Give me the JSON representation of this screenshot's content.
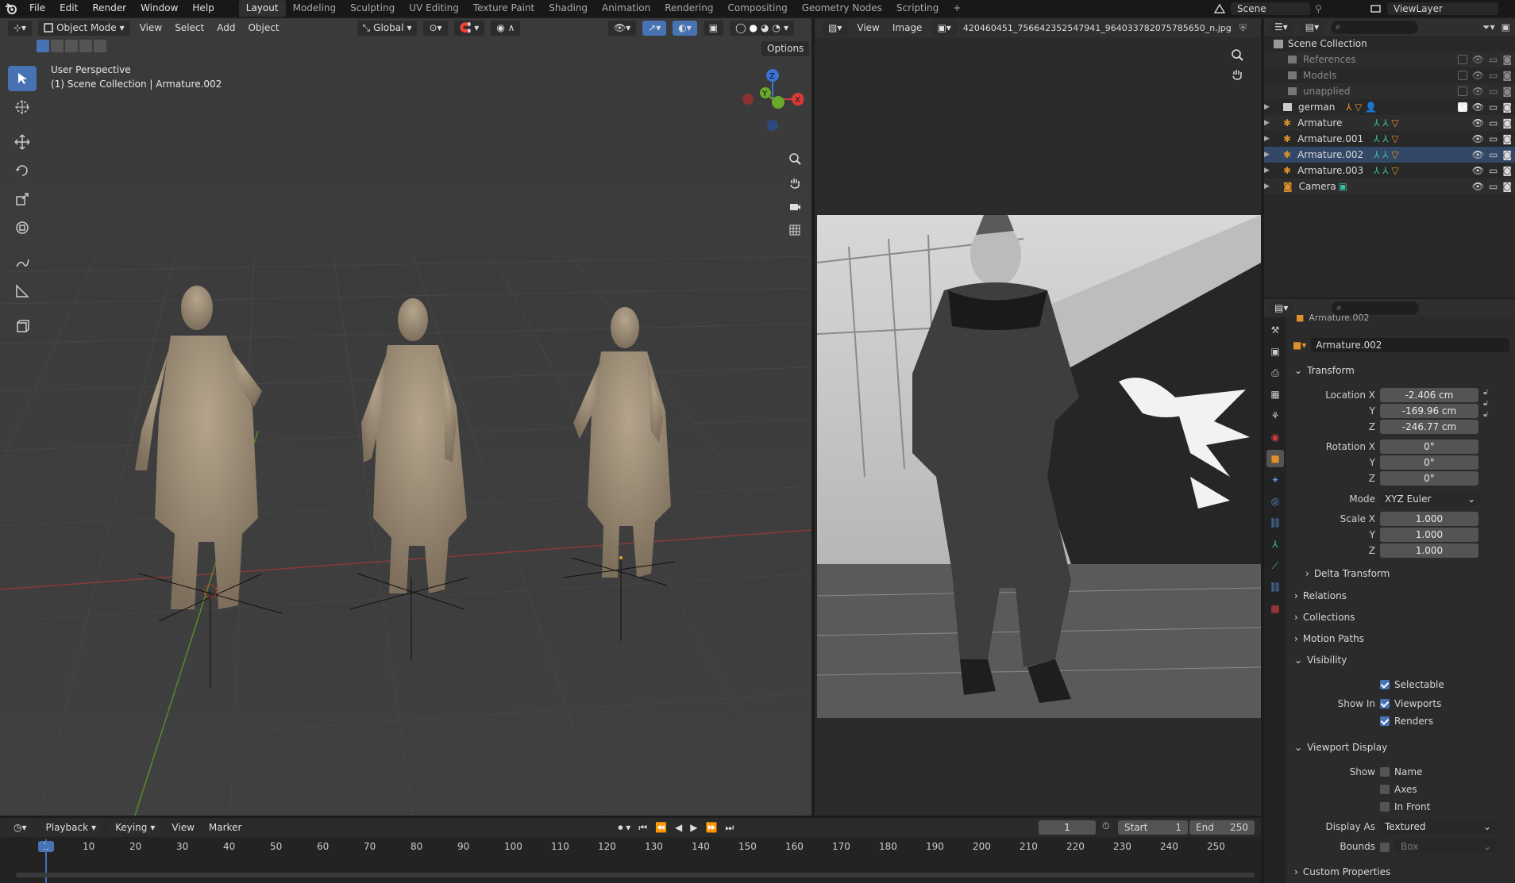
{
  "topbar": {
    "menus": [
      "File",
      "Edit",
      "Render",
      "Window",
      "Help"
    ],
    "workspaces": [
      "Layout",
      "Modeling",
      "Sculpting",
      "UV Editing",
      "Texture Paint",
      "Shading",
      "Animation",
      "Rendering",
      "Compositing",
      "Geometry Nodes",
      "Scripting"
    ],
    "active_workspace": "Layout",
    "scene": "Scene",
    "view_layer": "ViewLayer"
  },
  "viewport": {
    "mode": "Object Mode",
    "menus": [
      "View",
      "Select",
      "Add",
      "Object"
    ],
    "transform_orientation": "Global",
    "options": "Options",
    "overlay_title": "User Perspective",
    "overlay_sub": "(1) Scene Collection | Armature.002",
    "gizmo": {
      "x": "X",
      "y": "Y",
      "z": "Z"
    }
  },
  "image_editor": {
    "menus": [
      "View",
      "Image"
    ],
    "filename": "420460451_756642352547941_964033782075785650_n.jpg"
  },
  "outliner": {
    "root": "Scene Collection",
    "items": [
      {
        "label": "References",
        "dim": true
      },
      {
        "label": "Models",
        "dim": true
      },
      {
        "label": "unapplied",
        "dim": true
      },
      {
        "label": "german",
        "dim": false
      },
      {
        "label": "Armature",
        "dim": false
      },
      {
        "label": "Armature.001",
        "dim": false
      },
      {
        "label": "Armature.002",
        "dim": false
      },
      {
        "label": "Armature.003",
        "dim": false
      },
      {
        "label": "Camera",
        "dim": false
      }
    ]
  },
  "properties": {
    "crumb": "Armature.002",
    "object_name": "Armature.002",
    "transform": {
      "title": "Transform",
      "location_x_label": "Location X",
      "location_x": "-2.406 cm",
      "y_label": "Y",
      "location_y": "-169.96 cm",
      "z_label": "Z",
      "location_z": "-246.77 cm",
      "rotation_x_label": "Rotation X",
      "rotation_x": "0°",
      "rotation_y": "0°",
      "rotation_z": "0°",
      "mode_label": "Mode",
      "mode": "XYZ Euler",
      "scale_x_label": "Scale X",
      "scale_x": "1.000",
      "scale_y": "1.000",
      "scale_z": "1.000"
    },
    "delta_transform": "Delta Transform",
    "relations": "Relations",
    "collections": "Collections",
    "motion_paths": "Motion Paths",
    "visibility": {
      "title": "Visibility",
      "selectable": "Selectable",
      "show_in_label": "Show In",
      "viewports": "Viewports",
      "renders": "Renders"
    },
    "viewport_display": {
      "title": "Viewport Display",
      "show_label": "Show",
      "name": "Name",
      "axes": "Axes",
      "in_front": "In Front",
      "display_as_label": "Display As",
      "display_as": "Textured",
      "bounds_label": "Bounds",
      "bounds": "Box"
    },
    "custom_properties": "Custom Properties"
  },
  "timeline": {
    "menus": [
      "Playback",
      "Keying",
      "View",
      "Marker"
    ],
    "current_frame": "1",
    "start_label": "Start",
    "start": "1",
    "end_label": "End",
    "end": "250",
    "ticks": [
      "10",
      "20",
      "30",
      "40",
      "50",
      "60",
      "70",
      "80",
      "90",
      "100",
      "110",
      "120",
      "130",
      "140",
      "150",
      "160",
      "170",
      "180",
      "190",
      "200",
      "210",
      "220",
      "230",
      "240",
      "250"
    ]
  }
}
